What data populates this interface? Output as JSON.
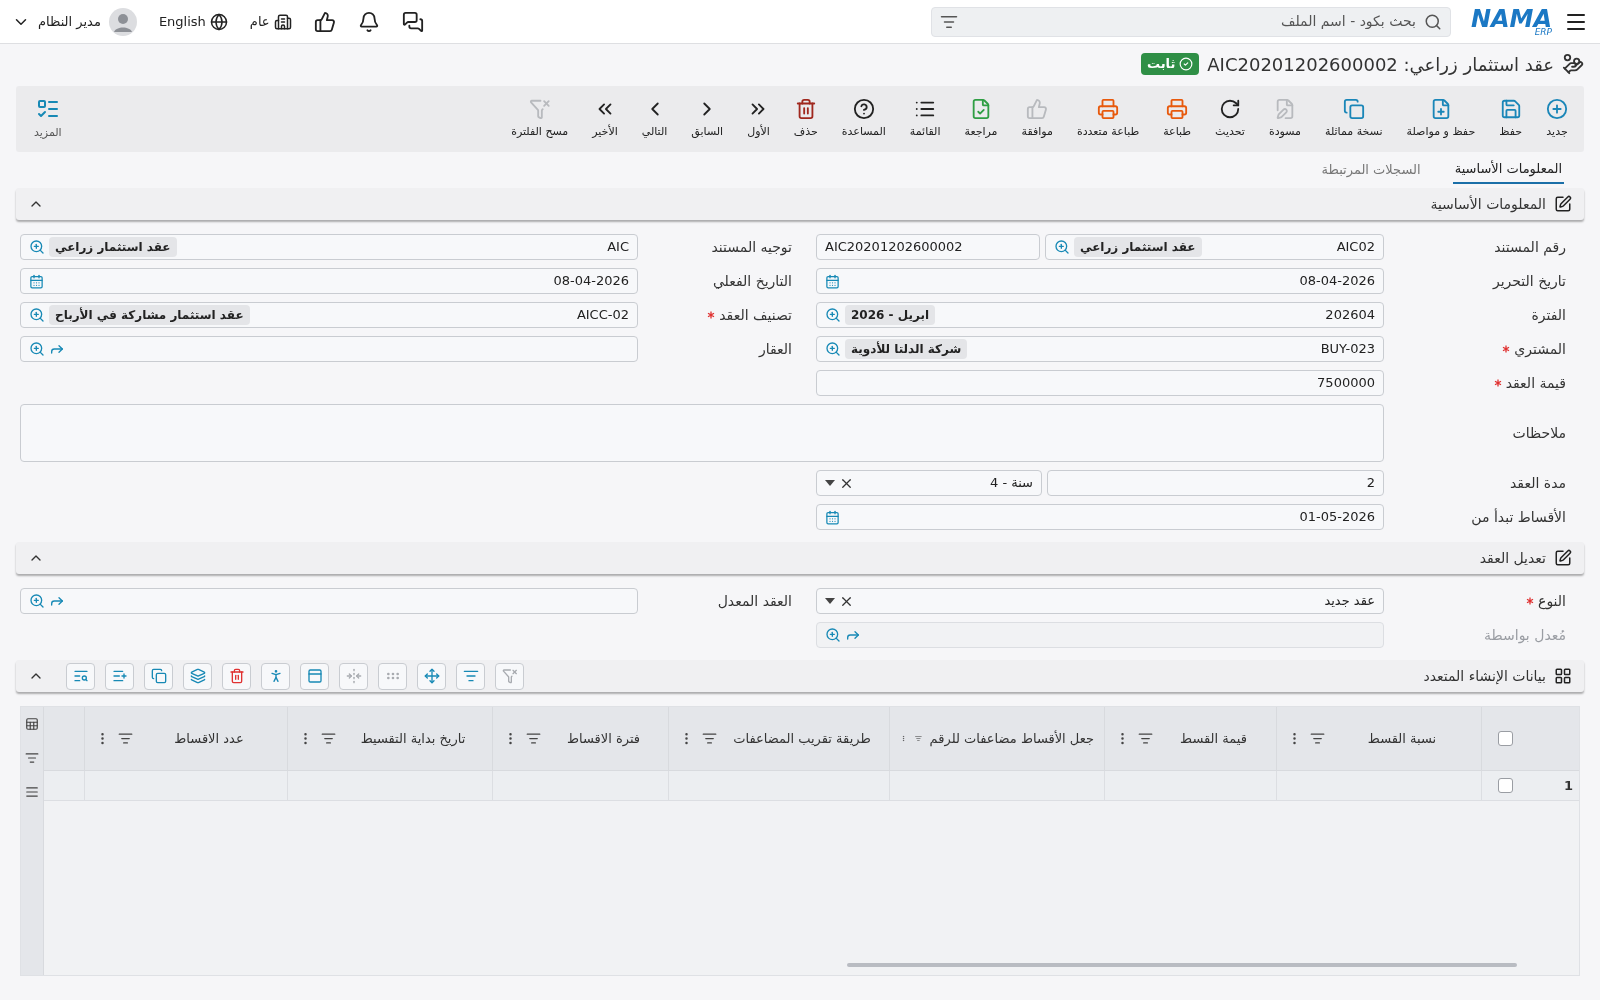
{
  "topbar": {
    "logo": "NAMA",
    "logo_sub": "ERP",
    "search": {
      "placeholder": "بحث بكود - اسم الملف"
    },
    "branch": "عام",
    "language": "English",
    "user": "مدير النظام"
  },
  "title": {
    "text": "عقد استثمار زراعي: AIC20201202600002",
    "status": "ثابت"
  },
  "toolbar": [
    {
      "label": "جديد",
      "color": "#1a86b8",
      "disabled": false
    },
    {
      "label": "حفظ",
      "color": "#1a86b8",
      "disabled": false
    },
    {
      "label": "حفظ و مواصلة",
      "color": "#1a86b8",
      "disabled": false
    },
    {
      "label": "نسخة مماثلة",
      "color": "#1a86b8",
      "disabled": false
    },
    {
      "label": "مسودة",
      "disabled": true
    },
    {
      "label": "تحديث",
      "color": "#222222",
      "disabled": false
    },
    {
      "label": "طباعة",
      "color": "#e8590c",
      "disabled": false
    },
    {
      "label": "طباعة متعددة",
      "color": "#e8590c",
      "disabled": false
    },
    {
      "label": "موافقة",
      "disabled": true
    },
    {
      "label": "مراجعة",
      "color": "#2f9e44",
      "disabled": false
    },
    {
      "label": "القائمة",
      "color": "#222222",
      "disabled": false
    },
    {
      "label": "المساعدة",
      "color": "#222222",
      "disabled": false
    },
    {
      "label": "حذف",
      "color": "#a0281e",
      "disabled": false
    },
    {
      "label": "الأول",
      "color": "#222222",
      "disabled": false
    },
    {
      "label": "السابق",
      "color": "#222222",
      "disabled": false
    },
    {
      "label": "التالي",
      "color": "#222222",
      "disabled": false
    },
    {
      "label": "الأخير",
      "color": "#222222",
      "disabled": false
    },
    {
      "label": "مسح الفلترة",
      "disabled": true
    }
  ],
  "more": "المزيد",
  "tabs": [
    {
      "label": "المعلومات الأساسية",
      "selected": true
    },
    {
      "label": "السجلات المرتبطة",
      "selected": false
    }
  ],
  "sections": [
    {
      "title": "المعلومات الأساسية",
      "kind": "form",
      "expanded": true,
      "rows": [
        {
          "cells": [
            {
              "label": "رقم المستند",
              "required": false,
              "disabled": false,
              "kind": "lookup_pair",
              "value": "AIC02",
              "chip": "عقد استثمار زراعي",
              "second": "AIC20201202600002"
            },
            {
              "label": "توجيه المستند",
              "required": false,
              "disabled": false,
              "kind": "lookup",
              "value": "AIC",
              "chip": "عقد استثمار زراعي"
            }
          ]
        },
        {
          "cells": [
            {
              "label": "تاريخ التحرير",
              "required": false,
              "disabled": false,
              "kind": "date",
              "value": "08-04-2026"
            },
            {
              "label": "التاريخ الفعلي",
              "required": false,
              "disabled": false,
              "kind": "date",
              "value": "08-04-2026"
            }
          ]
        },
        {
          "cells": [
            {
              "label": "الفترة",
              "required": false,
              "disabled": false,
              "kind": "lookup",
              "value": "202604",
              "chip": "ابريل - 2026"
            },
            {
              "label": "تصنيف العقد",
              "required": true,
              "disabled": false,
              "kind": "lookup",
              "value": "AICC-02",
              "chip": "عقد استثمار مشاركة في الأرباح"
            }
          ]
        },
        {
          "cells": [
            {
              "label": "المشتري",
              "required": true,
              "disabled": false,
              "kind": "lookup",
              "value": "BUY-023",
              "chip": "شركة الدلتا للأدوية"
            },
            {
              "label": "العقار",
              "required": false,
              "disabled": false,
              "kind": "link_lookup"
            }
          ]
        },
        {
          "cells": [
            {
              "label": "قيمة العقد",
              "required": true,
              "disabled": false,
              "kind": "text",
              "value": "7500000"
            }
          ]
        },
        {
          "cells": [
            {
              "label": "ملاحظات",
              "required": false,
              "disabled": false,
              "kind": "textarea"
            }
          ]
        },
        {
          "cells": [
            {
              "label": "مدة العقد",
              "required": false,
              "disabled": false,
              "kind": "duration",
              "value": "2",
              "unit": "سنة - 4"
            }
          ]
        },
        {
          "cells": [
            {
              "label": "الأقساط تبدأ من",
              "required": false,
              "disabled": false,
              "kind": "date",
              "value": "01-05-2026"
            }
          ]
        }
      ]
    },
    {
      "title": "تعديل العقد",
      "kind": "form",
      "expanded": true,
      "rows": [
        {
          "cells": [
            {
              "label": "النوع",
              "required": true,
              "disabled": false,
              "kind": "select",
              "value": "عقد جديد"
            },
            {
              "label": "العقد المعدل",
              "required": false,
              "disabled": false,
              "kind": "link_lookup"
            }
          ]
        },
        {
          "cells": [
            {
              "label": "مُعدل بواسطة",
              "required": false,
              "disabled": true,
              "kind": "link_lookup"
            }
          ]
        }
      ]
    },
    {
      "title": "بيانات الإنشاء المتعدد",
      "kind": "grid",
      "expanded": true,
      "tools": [
        {
          "disabled": true
        },
        {
          "disabled": false
        },
        {
          "disabled": false
        },
        {
          "disabled": true
        },
        {
          "disabled": true
        },
        {
          "disabled": false
        },
        {
          "disabled": false
        },
        {
          "disabled": false
        },
        {
          "disabled": false
        },
        {
          "disabled": false
        },
        {
          "disabled": false
        },
        {
          "disabled": false
        }
      ],
      "header_checked": false,
      "columns": [
        "نسبة القسط",
        "قيمة القسط",
        "جعل الأقساط مضاعفات للرقم",
        "طريقة تقريب المضاعفات",
        "فترة الاقساط",
        "تاريخ بداية التقسيط",
        "عدد الاقساط"
      ],
      "rows": [
        {
          "number": "1",
          "checked": false
        }
      ]
    }
  ]
}
